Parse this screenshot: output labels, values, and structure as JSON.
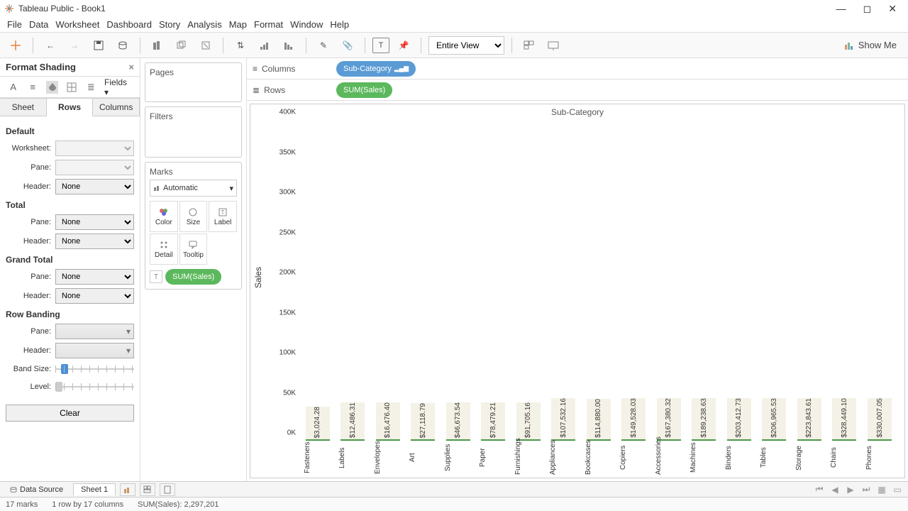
{
  "window": {
    "title": "Tableau Public - Book1"
  },
  "menu": [
    "File",
    "Data",
    "Worksheet",
    "Dashboard",
    "Story",
    "Analysis",
    "Map",
    "Format",
    "Window",
    "Help"
  ],
  "toolbar": {
    "fit": "Entire View",
    "showme": "Show Me"
  },
  "format": {
    "title": "Format Shading",
    "fields": "Fields ▾",
    "tabs": [
      "Sheet",
      "Rows",
      "Columns"
    ],
    "active_tab": 1,
    "sections": {
      "default": "Default",
      "total": "Total",
      "grand_total": "Grand Total",
      "row_banding": "Row Banding"
    },
    "labels": {
      "worksheet": "Worksheet:",
      "pane": "Pane:",
      "header": "Header:",
      "band_size": "Band Size:",
      "level": "Level:"
    },
    "none": "None",
    "clear": "Clear"
  },
  "cards": {
    "pages": "Pages",
    "filters": "Filters",
    "marks": "Marks",
    "marks_type": "Automatic",
    "cells": [
      "Color",
      "Size",
      "Label",
      "Detail",
      "Tooltip"
    ],
    "marks_pill": "SUM(Sales)"
  },
  "shelves": {
    "columns": "Columns",
    "rows": "Rows",
    "col_pill": "Sub-Category",
    "row_pill": "SUM(Sales)"
  },
  "viz": {
    "title": "Sub-Category",
    "ylabel": "Sales",
    "max_y": 400000
  },
  "tabs": {
    "data_source": "Data Source",
    "sheet": "Sheet 1"
  },
  "status": {
    "marks": "17 marks",
    "layout": "1 row by 17 columns",
    "sum": "SUM(Sales): 2,297,201"
  },
  "chart_data": {
    "type": "bar",
    "title": "Sub-Category",
    "ylabel": "Sales",
    "ylim": [
      0,
      400000
    ],
    "yticks": [
      "0K",
      "50K",
      "100K",
      "150K",
      "200K",
      "250K",
      "300K",
      "350K",
      "400K"
    ],
    "categories": [
      "Fasteners",
      "Labels",
      "Envelopes",
      "Art",
      "Supplies",
      "Paper",
      "Furnishings",
      "Appliances",
      "Bookcases",
      "Copiers",
      "Accessories",
      "Machines",
      "Binders",
      "Tables",
      "Storage",
      "Chairs",
      "Phones"
    ],
    "values": [
      3024.28,
      12486.31,
      16476.4,
      27118.79,
      46673.54,
      78479.21,
      91705.16,
      107532.16,
      114880.0,
      149528.03,
      167380.32,
      189238.63,
      203412.73,
      206965.53,
      223843.61,
      328449.1,
      330007.05
    ],
    "value_labels": [
      "$3,024.28",
      "$12,486.31",
      "$16,476.40",
      "$27,118.79",
      "$46,673.54",
      "$78,479.21",
      "$91,705.16",
      "$107,532.16",
      "$114,880.00",
      "$149,528.03",
      "$167,380.32",
      "$189,238.63",
      "$203,412.73",
      "$206,965.53",
      "$223,843.61",
      "$328,449.10",
      "$330,007.05"
    ]
  }
}
